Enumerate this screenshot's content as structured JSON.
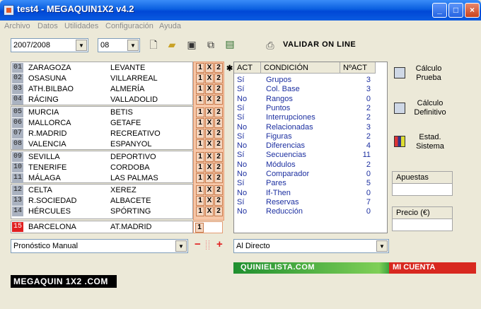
{
  "window": {
    "title": "test4 - MEGAQUIN1X2 v4.2",
    "minimize_symbol": "_",
    "maximize_symbol": "□",
    "close_symbol": "×"
  },
  "menu": [
    "Archivo",
    "Datos",
    "Utilidades",
    "Configuración",
    "Ayuda"
  ],
  "toolbar": {
    "season": "2007/2008",
    "jornada": "08",
    "validar_label": "VALIDAR ON LINE",
    "icons": [
      "new-document-icon",
      "open-folder-icon",
      "save-disk-icon",
      "print-preview-icon",
      "report-icon",
      "printer-icon"
    ]
  },
  "matches": [
    {
      "num": "01",
      "home": "ZARAGOZA",
      "away": "LEVANTE"
    },
    {
      "num": "02",
      "home": "OSASUNA",
      "away": "VILLARREAL"
    },
    {
      "num": "03",
      "home": "ATH.BILBAO",
      "away": "ALMERÍA"
    },
    {
      "num": "04",
      "home": "RÁCING",
      "away": "VALLADOLID"
    },
    {
      "num": "05",
      "home": "MURCIA",
      "away": "BETIS"
    },
    {
      "num": "06",
      "home": "MALLORCA",
      "away": "GETAFE"
    },
    {
      "num": "07",
      "home": "R.MADRID",
      "away": "RECREATIVO"
    },
    {
      "num": "08",
      "home": "VALENCIA",
      "away": "ESPANYOL"
    },
    {
      "num": "09",
      "home": "SEVILLA",
      "away": "DEPORTIVO"
    },
    {
      "num": "10",
      "home": "TENERIFE",
      "away": "CORDOBA"
    },
    {
      "num": "11",
      "home": "MÁLAGA",
      "away": "LAS PALMAS"
    },
    {
      "num": "12",
      "home": "CELTA",
      "away": "XEREZ"
    },
    {
      "num": "13",
      "home": "R.SOCIEDAD",
      "away": "ALBACETE"
    },
    {
      "num": "14",
      "home": "HÉRCULES",
      "away": "SPÓRTING"
    },
    {
      "num": "15",
      "home": "BARCELONA",
      "away": "AT.MADRID"
    }
  ],
  "signs": [
    "1",
    "X",
    "2"
  ],
  "final_sign": "1",
  "star": "✱",
  "conditions": {
    "headers": {
      "act": "ACT",
      "condicion": "CONDICIÓN",
      "num": "NºACT"
    },
    "rows": [
      {
        "act": "Sí",
        "name": "Grupos",
        "num": "3"
      },
      {
        "act": "Sí",
        "name": "Col. Base",
        "num": "3"
      },
      {
        "act": "No",
        "name": "Rangos",
        "num": "0"
      },
      {
        "act": "Sí",
        "name": "Puntos",
        "num": "2"
      },
      {
        "act": "Sí",
        "name": "Interrupciones",
        "num": "2"
      },
      {
        "act": "No",
        "name": "Relacionadas",
        "num": "3"
      },
      {
        "act": "Sí",
        "name": "Figuras",
        "num": "2"
      },
      {
        "act": "No",
        "name": "Diferencias",
        "num": "4"
      },
      {
        "act": "Sí",
        "name": "Secuencias",
        "num": "11"
      },
      {
        "act": "No",
        "name": "Módulos",
        "num": "2"
      },
      {
        "act": "No",
        "name": "Comparador",
        "num": "0"
      },
      {
        "act": "Sí",
        "name": "Pares",
        "num": "5"
      },
      {
        "act": "No",
        "name": "If-Then",
        "num": "0"
      },
      {
        "act": "Sí",
        "name": "Reservas",
        "num": "7"
      },
      {
        "act": "No",
        "name": "Reducción",
        "num": "0"
      }
    ]
  },
  "side": {
    "calculo_prueba": [
      "Cálculo",
      "Prueba"
    ],
    "calculo_definitivo": [
      "Cálculo",
      "Definitivo"
    ],
    "estad_sistema": [
      "Estad.",
      "Sistema"
    ],
    "apuestas_label": "Apuestas",
    "apuestas_value": "",
    "precio_label": "Precio (€)",
    "precio_value": ""
  },
  "bottom": {
    "pronostico": "Pronóstico Manual",
    "minus": "−",
    "plus": "+",
    "al_directo": "Al Directo",
    "quinielista": "QUINIELISTA.COM",
    "mi_cuenta": "MI CUENTA",
    "logo": "MEGAQUIN 1X2 .COM"
  }
}
